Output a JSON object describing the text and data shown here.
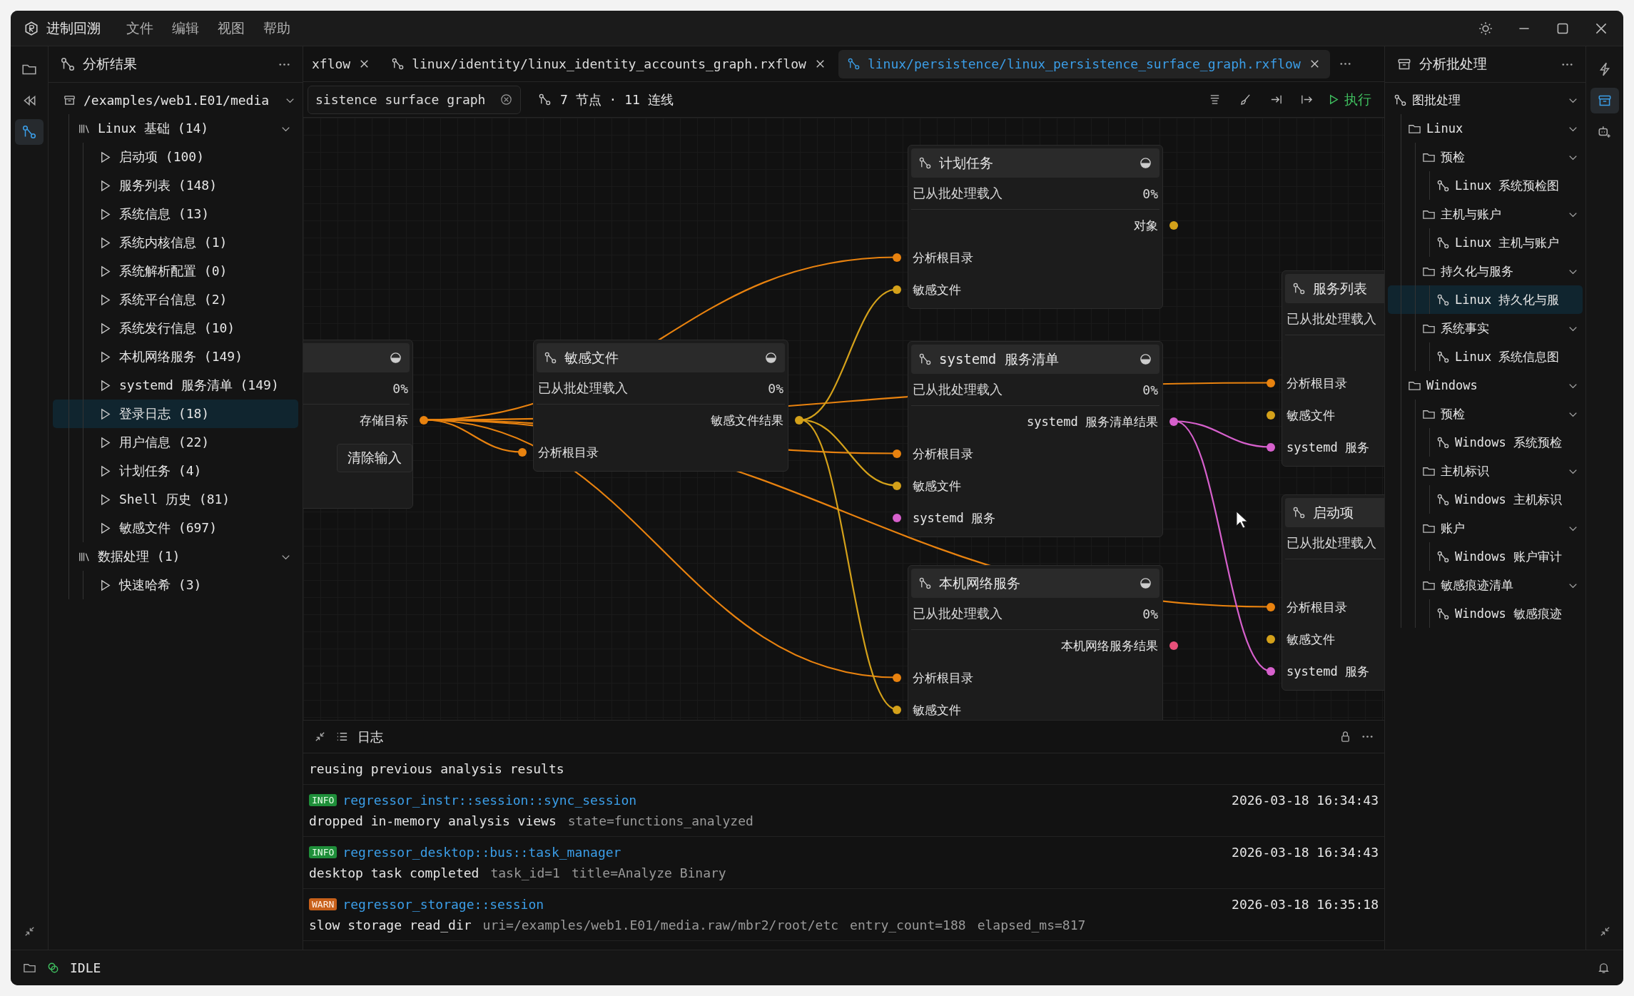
{
  "app": {
    "title": "进制回溯",
    "menu": [
      "文件",
      "编辑",
      "视图",
      "帮助"
    ]
  },
  "activity_left": [
    {
      "kind": "folder",
      "selected": false
    },
    {
      "kind": "rewind",
      "selected": false
    },
    {
      "kind": "flow",
      "selected": true
    }
  ],
  "left_panel": {
    "title": "分析结果",
    "tree": {
      "label": "/examples/web1.E01/media",
      "kind": "source",
      "expanded": true,
      "children": [
        {
          "label": "Linux 基础 (14)",
          "kind": "group",
          "expanded": true,
          "children": [
            {
              "label": "启动项 (100)",
              "kind": "item",
              "selected": false
            },
            {
              "label": "服务列表 (148)",
              "kind": "item",
              "selected": false
            },
            {
              "label": "系统信息 (13)",
              "kind": "item",
              "selected": false
            },
            {
              "label": "系统内核信息 (1)",
              "kind": "item",
              "selected": false
            },
            {
              "label": "系统解析配置 (0)",
              "kind": "item",
              "selected": false
            },
            {
              "label": "系统平台信息 (2)",
              "kind": "item",
              "selected": false
            },
            {
              "label": "系统发行信息 (10)",
              "kind": "item",
              "selected": false
            },
            {
              "label": "本机网络服务 (149)",
              "kind": "item",
              "selected": false
            },
            {
              "label": "systemd 服务清单 (149)",
              "kind": "item",
              "selected": false
            },
            {
              "label": "登录日志 (18)",
              "kind": "item",
              "selected": true
            },
            {
              "label": "用户信息 (22)",
              "kind": "item",
              "selected": false
            },
            {
              "label": "计划任务 (4)",
              "kind": "item",
              "selected": false
            },
            {
              "label": "Shell 历史 (81)",
              "kind": "item",
              "selected": false
            },
            {
              "label": "敏感文件 (697)",
              "kind": "item",
              "selected": false
            }
          ]
        },
        {
          "label": "数据处理 (1)",
          "kind": "group",
          "expanded": true,
          "children": [
            {
              "label": "快速哈希 (3)",
              "kind": "item",
              "selected": false
            }
          ]
        }
      ]
    }
  },
  "tabs": [
    {
      "label": "xflow",
      "icon": false,
      "selected": false
    },
    {
      "label": "linux/identity/linux_identity_accounts_graph.rxflow",
      "icon": true,
      "selected": false
    },
    {
      "label": "linux/persistence/linux_persistence_surface_graph.rxflow",
      "icon": true,
      "selected": true
    }
  ],
  "toolbar": {
    "search": {
      "value": "sistence surface graph"
    },
    "stats": "7 节点 · 11 连线",
    "run_label": "执行"
  },
  "nodes": [
    {
      "collapsible": true,
      "percent": "0%",
      "outputs": [
        {
          "label": "存储目标",
          "color": "#e8820f"
        }
      ],
      "action": "清除输入"
    },
    {
      "title": "敏感文件",
      "collapsible": true,
      "status": "已从批处理载入",
      "percent": "0%",
      "outputs": [
        {
          "label": "敏感文件结果",
          "color": "#d4a11a"
        }
      ],
      "inputs": [
        {
          "label": "分析根目录",
          "color": "#e8820f"
        }
      ]
    },
    {
      "title": "计划任务",
      "collapsible": true,
      "status": "已从批处理载入",
      "percent": "0%",
      "outputs": [
        {
          "label": "对象",
          "color": "#d4a11a"
        }
      ],
      "inputs": [
        {
          "label": "分析根目录",
          "color": "#e8820f"
        },
        {
          "label": "敏感文件",
          "color": "#d4a11a"
        }
      ]
    },
    {
      "title": "systemd 服务清单",
      "collapsible": true,
      "status": "已从批处理载入",
      "percent": "0%",
      "outputs": [
        {
          "label": "systemd 服务清单结果",
          "color": "#d660cc"
        }
      ],
      "inputs": [
        {
          "label": "分析根目录",
          "color": "#e8820f"
        },
        {
          "label": "敏感文件",
          "color": "#d4a11a"
        },
        {
          "label": "systemd 服务",
          "color": "#d660cc"
        }
      ]
    },
    {
      "title": "本机网络服务",
      "collapsible": true,
      "status": "已从批处理载入",
      "percent": "0%",
      "outputs": [
        {
          "label": "本机网络服务结果",
          "color": "#e8507a"
        }
      ],
      "inputs": [
        {
          "label": "分析根目录",
          "color": "#e8820f"
        },
        {
          "label": "敏感文件",
          "color": "#d4a11a"
        }
      ]
    },
    {
      "title": "服务列表",
      "collapsible": false,
      "status": "已从批处理载入",
      "inputs": [
        {
          "label": "分析根目录",
          "color": "#e8820f"
        },
        {
          "label": "敏感文件",
          "color": "#d4a11a"
        },
        {
          "label": "systemd 服务",
          "color": "#d660cc"
        }
      ]
    },
    {
      "title": "启动项",
      "collapsible": false,
      "status": "已从批处理载入",
      "inputs": [
        {
          "label": "分析根目录",
          "color": "#e8820f"
        },
        {
          "label": "敏感文件",
          "color": "#d4a11a"
        },
        {
          "label": "systemd 服务",
          "color": "#d660cc"
        }
      ]
    }
  ],
  "log": {
    "title": "日志",
    "entries": [
      {
        "kind": "plain",
        "message": "reusing previous analysis results"
      },
      {
        "kind": "info",
        "level": "INFO",
        "source": "regressor_instr::session::sync_session",
        "time": "2026-03-18 16:34:43",
        "message": "dropped in-memory analysis views",
        "fields": [
          "state=functions_analyzed"
        ]
      },
      {
        "kind": "info",
        "level": "INFO",
        "source": "regressor_desktop::bus::task_manager",
        "time": "2026-03-18 16:34:43",
        "message": "desktop task completed",
        "fields": [
          "task_id=1",
          "title=Analyze Binary"
        ]
      },
      {
        "kind": "warn",
        "level": "WARN",
        "source": "regressor_storage::session",
        "time": "2026-03-18 16:35:18",
        "message": "slow storage read_dir",
        "fields": [
          "uri=/examples/web1.E01/media.raw/mbr2/root/etc",
          "entry_count=188",
          "elapsed_ms=817"
        ]
      }
    ]
  },
  "right_panel": {
    "title": "分析批处理",
    "tree": {
      "label": "图批处理",
      "kind": "batch",
      "expanded": true,
      "children": [
        {
          "label": "Linux",
          "kind": "folder",
          "expanded": true,
          "children": [
            {
              "label": "预检",
              "kind": "folder",
              "expanded": true,
              "children": [
                {
                  "label": "Linux 系统预检图",
                  "kind": "graph",
                  "selected": false
                }
              ]
            },
            {
              "label": "主机与账户",
              "kind": "folder",
              "expanded": true,
              "children": [
                {
                  "label": "Linux 主机与账户",
                  "kind": "graph",
                  "selected": false
                }
              ]
            },
            {
              "label": "持久化与服务",
              "kind": "folder",
              "expanded": true,
              "children": [
                {
                  "label": "Linux 持久化与服",
                  "kind": "graph",
                  "selected": true
                }
              ]
            },
            {
              "label": "系统事实",
              "kind": "folder",
              "expanded": true,
              "children": [
                {
                  "label": "Linux 系统信息图",
                  "kind": "graph",
                  "selected": false
                }
              ]
            }
          ]
        },
        {
          "label": "Windows",
          "kind": "folder",
          "expanded": true,
          "children": [
            {
              "label": "预检",
              "kind": "folder",
              "expanded": true,
              "children": [
                {
                  "label": "Windows 系统预检",
                  "kind": "graph",
                  "selected": false
                }
              ]
            },
            {
              "label": "主机标识",
              "kind": "folder",
              "expanded": true,
              "children": [
                {
                  "label": "Windows 主机标识",
                  "kind": "graph",
                  "selected": false
                }
              ]
            },
            {
              "label": "账户",
              "kind": "folder",
              "expanded": true,
              "children": [
                {
                  "label": "Windows 账户审计",
                  "kind": "graph",
                  "selected": false
                }
              ]
            },
            {
              "label": "敏感痕迹清单",
              "kind": "folder",
              "expanded": true,
              "children": [
                {
                  "label": "Windows 敏感痕迹",
                  "kind": "graph",
                  "selected": false
                }
              ]
            }
          ]
        }
      ]
    }
  },
  "activity_right": [
    {
      "kind": "bolt",
      "selected": false
    },
    {
      "kind": "archive",
      "selected": true
    },
    {
      "kind": "robot",
      "selected": false
    }
  ],
  "status_bar": {
    "state": "IDLE"
  }
}
